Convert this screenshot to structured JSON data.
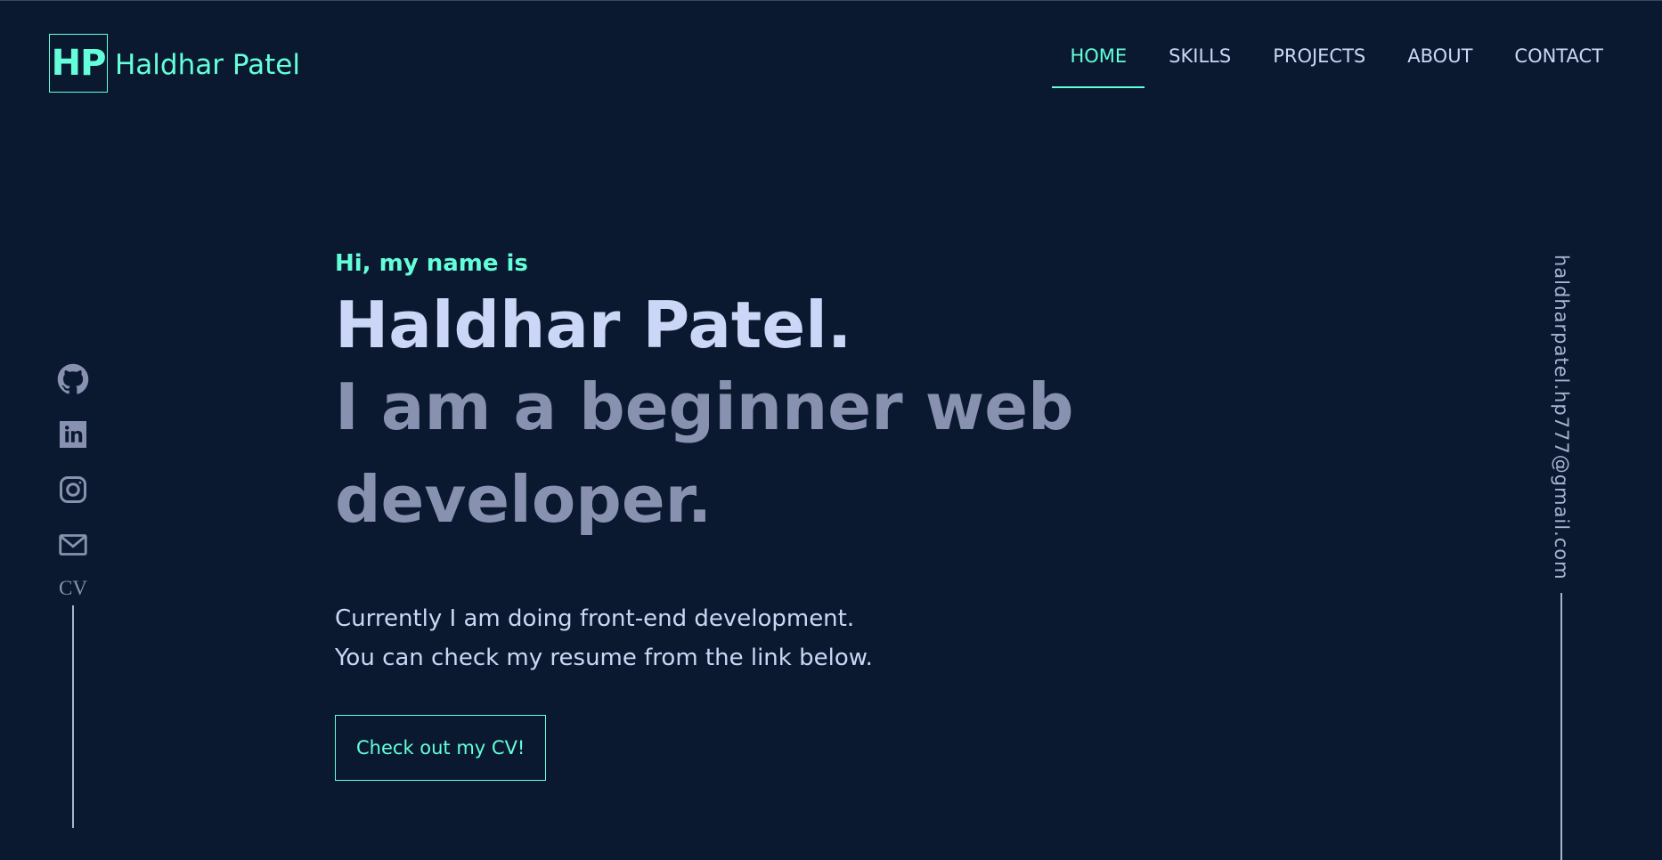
{
  "header": {
    "logo_initials": "HP",
    "logo_name": "Haldhar Patel",
    "nav": [
      {
        "label": "HOME",
        "active": true
      },
      {
        "label": "SKILLS",
        "active": false
      },
      {
        "label": "PROJECTS",
        "active": false
      },
      {
        "label": "ABOUT",
        "active": false
      },
      {
        "label": "CONTACT",
        "active": false
      }
    ]
  },
  "social": {
    "icons": [
      "github-icon",
      "linkedin-icon",
      "instagram-icon",
      "mail-icon"
    ],
    "cv_label": "CV"
  },
  "side_email": "haldharpatel.hp777@gmail.com",
  "hero": {
    "greeting": "Hi, my name is",
    "name": "Haldhar Patel.",
    "tagline": "I am a beginner web developer.",
    "description_line1": "Currently I am doing front-end development.",
    "description_line2": "You can check my resume from the link below.",
    "cta_label": "Check out my CV!"
  },
  "colors": {
    "background": "#0a192f",
    "accent": "#64ffda",
    "heading": "#ccd6f6",
    "muted": "#8892b0"
  }
}
